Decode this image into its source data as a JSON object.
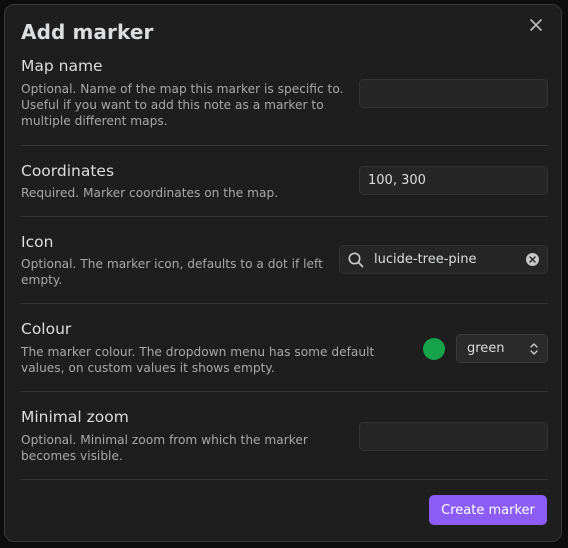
{
  "modal": {
    "title": "Add marker",
    "close_icon": "close-icon"
  },
  "settings": {
    "map_name": {
      "name": "Map name",
      "desc": "Optional. Name of the map this marker is specific to. Useful if you want to add this note as a marker to multiple different maps.",
      "value": ""
    },
    "coordinates": {
      "name": "Coordinates",
      "desc": "Required. Marker coordinates on the map.",
      "value": "100, 300"
    },
    "icon": {
      "name": "Icon",
      "desc": "Optional. The marker icon, defaults to a dot if left empty.",
      "value": "lucide-tree-pine",
      "search_icon": "search-icon",
      "clear_icon": "clear-icon"
    },
    "colour": {
      "name": "Colour",
      "desc": "The marker colour. The dropdown menu has some default values, on custom values it shows empty.",
      "swatch_color": "#16a34a",
      "selected": "green"
    },
    "minimal_zoom": {
      "name": "Minimal zoom",
      "desc": "Optional. Minimal zoom from which the marker becomes visible.",
      "value": ""
    }
  },
  "actions": {
    "create_label": "Create marker",
    "accent_color": "#8b5cf6"
  }
}
